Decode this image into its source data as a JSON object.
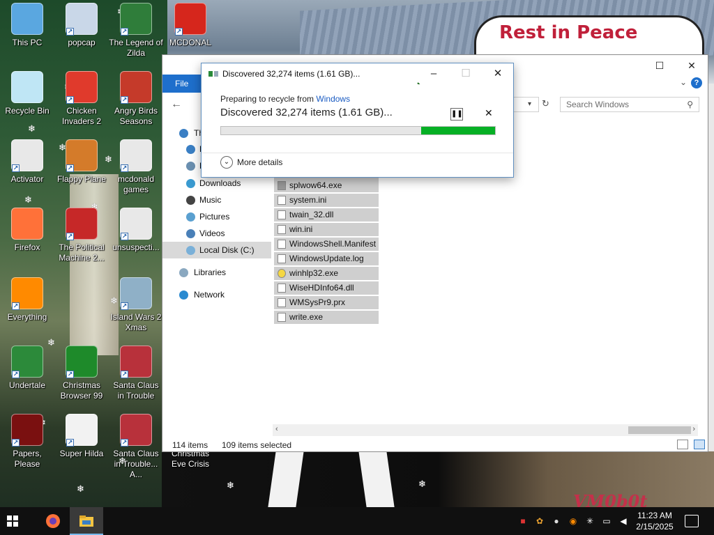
{
  "wallpaper": {
    "sign_text": "Rest in Peace",
    "watermark": "VM0b0t"
  },
  "desktop_icons": [
    {
      "id": "this-pc",
      "label": "This PC",
      "icon": "computer-icon",
      "color": "#5aa7e0"
    },
    {
      "id": "popcap",
      "label": "popcap",
      "icon": "popcap-icon",
      "color": "#c9d7e8"
    },
    {
      "id": "legend-of-zilda",
      "label": "The Legend of Zilda",
      "icon": "zelda-icon",
      "color": "#2f7d3a"
    },
    {
      "id": "mcdonal",
      "label": "MCDONAL",
      "icon": "mcdonalds-icon",
      "color": "#d6261c"
    },
    {
      "id": "recycle-bin",
      "label": "Recycle Bin",
      "icon": "recycle-bin-icon",
      "color": "#bfe6f5"
    },
    {
      "id": "chicken-invaders-2",
      "label": "Chicken Invaders 2",
      "icon": "chicken-icon",
      "color": "#e03a2c"
    },
    {
      "id": "angry-birds-seasons",
      "label": "Angry Birds Seasons",
      "icon": "angry-birds-icon",
      "color": "#c53a2a"
    },
    {
      "id": "activator",
      "label": "Activator",
      "icon": "folder-icon",
      "color": "#e8e8e8"
    },
    {
      "id": "flappy-plane",
      "label": "Flappy Plane",
      "icon": "plane-icon",
      "color": "#d47b2a"
    },
    {
      "id": "mcdonald-games",
      "label": "mcdonald games",
      "icon": "folder-icon",
      "color": "#e8e8e8"
    },
    {
      "id": "firefox",
      "label": "Firefox",
      "icon": "firefox-icon",
      "color": "#ff7139"
    },
    {
      "id": "political-machine",
      "label": "The Political Machine 2...",
      "icon": "political-icon",
      "color": "#c62828"
    },
    {
      "id": "unsuspecti",
      "label": "unsuspecti...",
      "icon": "folder-icon",
      "color": "#e8e8e8"
    },
    {
      "id": "everything",
      "label": "Everything",
      "icon": "magnifier-icon",
      "color": "#ff8a00"
    },
    {
      "id": "island-wars-2-xmas",
      "label": "Island Wars 2 Xmas",
      "icon": "island-icon",
      "color": "#8fb0c7"
    },
    {
      "id": "undertale",
      "label": "Undertale",
      "icon": "undertale-icon",
      "color": "#2c8a3a"
    },
    {
      "id": "christmas-browser-99",
      "label": "Christmas Browser 99",
      "icon": "xmas-tree-icon",
      "color": "#1e8a2a"
    },
    {
      "id": "santa-claus-trouble",
      "label": "Santa Claus in Trouble",
      "icon": "santa-icon",
      "color": "#b8313b"
    },
    {
      "id": "papers-please",
      "label": "Papers, Please",
      "icon": "papers-please-icon",
      "color": "#7a1010"
    },
    {
      "id": "super-hilda",
      "label": "Super Hilda",
      "icon": "hilda-icon",
      "color": "#f2f2f2"
    },
    {
      "id": "santa-claus-trouble-a",
      "label": "Santa Claus in Trouble... A...",
      "icon": "santa-icon",
      "color": "#b8313b"
    },
    {
      "id": "christmas-eve-crisis",
      "label": "Christmas Eve Crisis",
      "icon": "none",
      "color": "#000000"
    }
  ],
  "explorer": {
    "file_tab": "File",
    "search_placeholder": "Search Windows",
    "nav_items": [
      {
        "label": "Th",
        "icon": "this-pc-icon",
        "color": "#3a7fc4"
      },
      {
        "label": "D",
        "icon": "desktop-icon",
        "color": "#3a7fc4"
      },
      {
        "label": "D",
        "icon": "documents-icon",
        "color": "#6a8fb0"
      },
      {
        "label": "Downloads",
        "icon": "downloads-icon",
        "color": "#3a9ad0"
      },
      {
        "label": "Music",
        "icon": "music-icon",
        "color": "#444444"
      },
      {
        "label": "Pictures",
        "icon": "pictures-icon",
        "color": "#5aa0d0"
      },
      {
        "label": "Videos",
        "icon": "videos-icon",
        "color": "#4a80b8"
      },
      {
        "label": "Local Disk (C:)",
        "icon": "disk-icon",
        "color": "#7ab0d8"
      },
      {
        "label": "Libraries",
        "icon": "libraries-icon",
        "color": "#8aa8c0"
      },
      {
        "label": "Network",
        "icon": "network-icon",
        "color": "#2a8ad0"
      }
    ],
    "files": [
      {
        "name": "splwow64.exe",
        "icon": "printer-icon"
      },
      {
        "name": "system.ini",
        "icon": "ini-file-icon"
      },
      {
        "name": "twain_32.dll",
        "icon": "dll-file-icon"
      },
      {
        "name": "win.ini",
        "icon": "ini-file-icon"
      },
      {
        "name": "WindowsShell.Manifest",
        "icon": "file-icon"
      },
      {
        "name": "WindowsUpdate.log",
        "icon": "log-file-icon"
      },
      {
        "name": "winhlp32.exe",
        "icon": "help-icon"
      },
      {
        "name": "WiseHDInfo64.dll",
        "icon": "dll-file-icon"
      },
      {
        "name": "WMSysPr9.prx",
        "icon": "file-icon"
      },
      {
        "name": "write.exe",
        "icon": "write-icon"
      }
    ],
    "status_items": "114 items",
    "status_selected": "109 items selected"
  },
  "dialog": {
    "title": "Discovered 32,274 items (1.61 GB)...",
    "preparing_text": "Preparing to recycle from",
    "source_link": "Windows",
    "headline": "Discovered 32,274 items (1.61 GB)...",
    "progress": 0.27,
    "more_details": "More details",
    "accent": "#06b025"
  },
  "taskbar": {
    "time": "11:23 AM",
    "date": "2/15/2025",
    "apps": [
      "start-icon",
      "firefox-icon",
      "file-explorer-icon"
    ],
    "tray": [
      "security-icon",
      "colorful-app-icon",
      "droplet-icon",
      "everything-icon",
      "snowflake-app-icon",
      "network-icon",
      "volume-muted-icon"
    ]
  }
}
